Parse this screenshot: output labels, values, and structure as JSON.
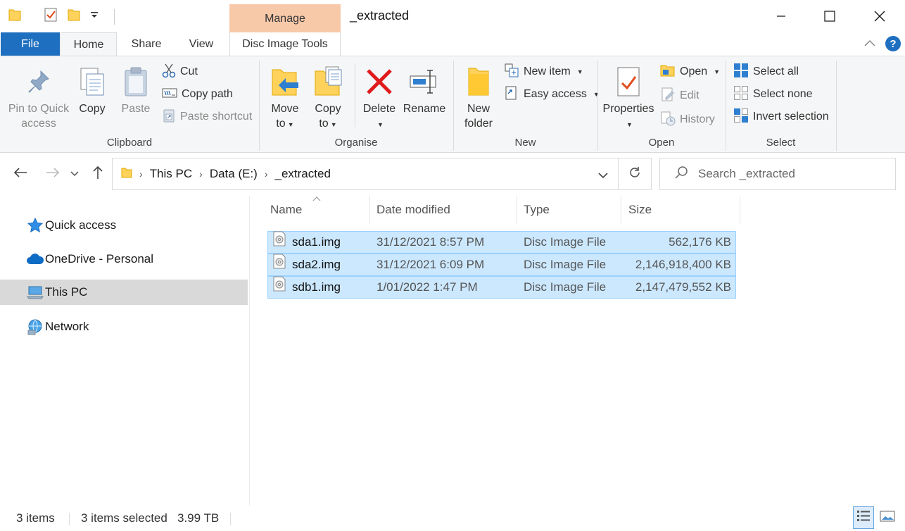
{
  "window": {
    "title": "_extracted",
    "context_tab": "Manage",
    "accent": "#1e6fbf",
    "context_color": "#f8c9a9"
  },
  "tabs": {
    "file": "File",
    "home": "Home",
    "share": "Share",
    "view": "View",
    "disc": "Disc Image Tools"
  },
  "ribbon": {
    "clipboard": {
      "label": "Clipboard",
      "pin_l1": "Pin to Quick",
      "pin_l2": "access",
      "copy": "Copy",
      "paste": "Paste",
      "cut": "Cut",
      "copy_path": "Copy path",
      "paste_shortcut": "Paste shortcut"
    },
    "organise": {
      "label": "Organise",
      "move_l1": "Move",
      "move_l2": "to",
      "copy_l1": "Copy",
      "copy_l2": "to",
      "delete": "Delete",
      "rename": "Rename"
    },
    "new": {
      "label": "New",
      "folder_l1": "New",
      "folder_l2": "folder",
      "new_item": "New item",
      "easy_access": "Easy access"
    },
    "open": {
      "label": "Open",
      "properties": "Properties",
      "open": "Open",
      "edit": "Edit",
      "history": "History"
    },
    "select": {
      "label": "Select",
      "select_all": "Select all",
      "select_none": "Select none",
      "invert": "Invert selection"
    }
  },
  "address": {
    "crumbs": [
      "This PC",
      "Data (E:)",
      "_extracted"
    ],
    "search_placeholder": "Search _extracted"
  },
  "nav": {
    "items": [
      "Quick access",
      "OneDrive - Personal",
      "This PC",
      "Network"
    ],
    "selected": "This PC"
  },
  "columns": {
    "name": "Name",
    "date": "Date modified",
    "type": "Type",
    "size": "Size"
  },
  "files": [
    {
      "name": "sda1.img",
      "date": "31/12/2021 8:57 PM",
      "type": "Disc Image File",
      "size": "562,176 KB"
    },
    {
      "name": "sda2.img",
      "date": "31/12/2021 6:09 PM",
      "type": "Disc Image File",
      "size": "2,146,918,400 KB"
    },
    {
      "name": "sdb1.img",
      "date": "1/01/2022 1:47 PM",
      "type": "Disc Image File",
      "size": "2,147,479,552 KB"
    }
  ],
  "status": {
    "items": "3 items",
    "selected": "3 items selected",
    "size": "3.99 TB"
  }
}
